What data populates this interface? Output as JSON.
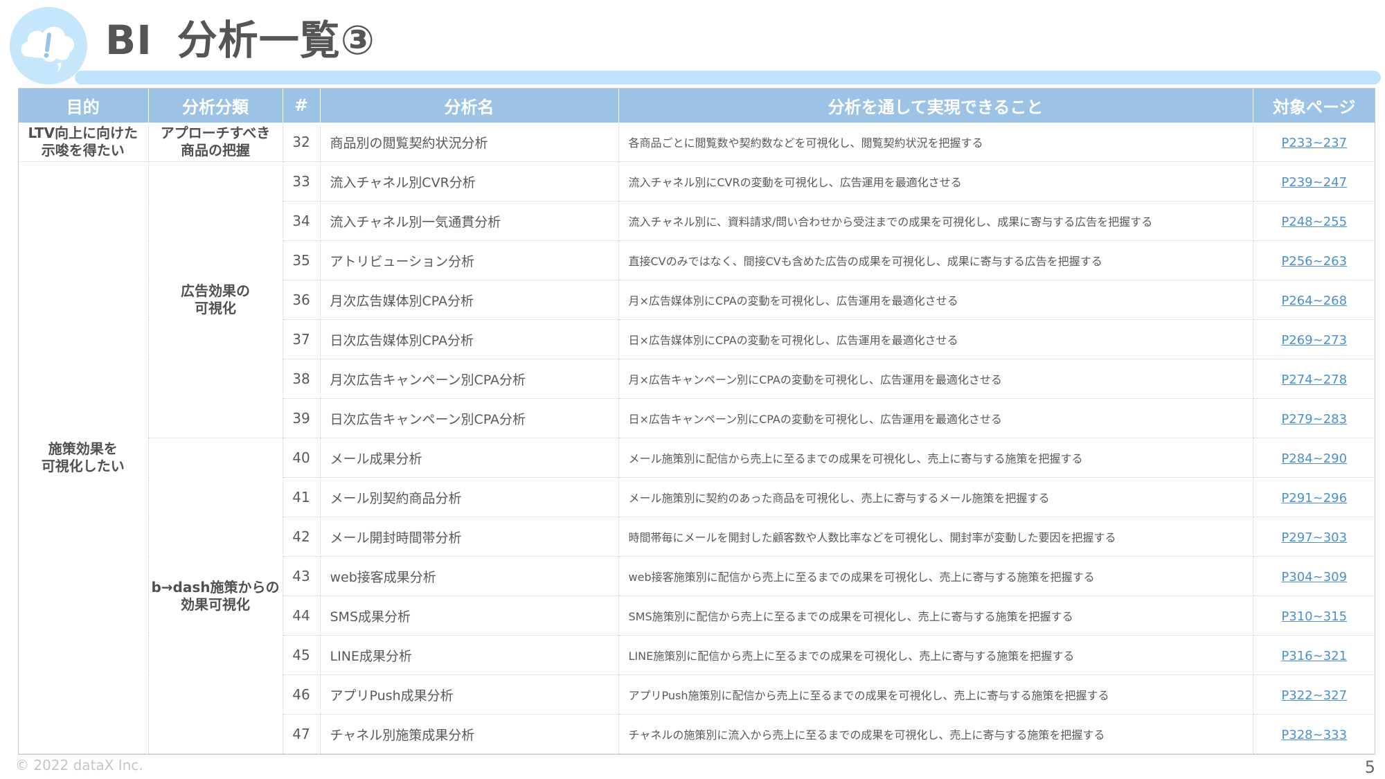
{
  "header": {
    "title_prefix": "BI",
    "title_main": "分析一覧③",
    "logo_icon": "cloud-exclamation-icon",
    "accent_color": "#c5e6fb",
    "header_color": "#9cc3e6",
    "link_color": "#4a8fd1"
  },
  "table": {
    "columns": [
      "目的",
      "分析分類",
      "#",
      "分析名",
      "分析を通して実現できること",
      "対象ページ"
    ],
    "purposes": [
      "LTV向上に向けた\n示唆を得たい",
      "施策効果を\n可視化したい"
    ],
    "categories": [
      "アプローチすべき\n商品の把握",
      "広告効果の\n可視化",
      "b→dash施策からの\n効果可視化"
    ],
    "rows": [
      {
        "num": "32",
        "name": "商品別の閲覧契約状況分析",
        "desc": "各商品ごとに閲覧数や契約数などを可視化し、閲覧契約状況を把握する",
        "page": "P233~237"
      },
      {
        "num": "33",
        "name": "流入チャネル別CVR分析",
        "desc": "流入チャネル別にCVRの変動を可視化し、広告運用を最適化させる",
        "page": "P239~247"
      },
      {
        "num": "34",
        "name": "流入チャネル別一気通貫分析",
        "desc": "流入チャネル別に、資料請求/問い合わせから受注までの成果を可視化し、成果に寄与する広告を把握する",
        "page": "P248~255"
      },
      {
        "num": "35",
        "name": "アトリビューション分析",
        "desc": "直接CVのみではなく、間接CVも含めた広告の成果を可視化し、成果に寄与する広告を把握する",
        "page": "P256~263"
      },
      {
        "num": "36",
        "name": "月次広告媒体別CPA分析",
        "desc": "月×広告媒体別にCPAの変動を可視化し、広告運用を最適化させる",
        "page": "P264~268"
      },
      {
        "num": "37",
        "name": "日次広告媒体別CPA分析",
        "desc": "日×広告媒体別にCPAの変動を可視化し、広告運用を最適化させる",
        "page": "P269~273"
      },
      {
        "num": "38",
        "name": "月次広告キャンペーン別CPA分析",
        "desc": "月×広告キャンペーン別にCPAの変動を可視化し、広告運用を最適化させる",
        "page": "P274~278"
      },
      {
        "num": "39",
        "name": "日次広告キャンペーン別CPA分析",
        "desc": "日×広告キャンペーン別にCPAの変動を可視化し、広告運用を最適化させる",
        "page": "P279~283"
      },
      {
        "num": "40",
        "name": "メール成果分析",
        "desc": "メール施策別に配信から売上に至るまでの成果を可視化し、売上に寄与する施策を把握する",
        "page": "P284~290"
      },
      {
        "num": "41",
        "name": "メール別契約商品分析",
        "desc": "メール施策別に契約のあった商品を可視化し、売上に寄与するメール施策を把握する",
        "page": "P291~296"
      },
      {
        "num": "42",
        "name": "メール開封時間帯分析",
        "desc": "時間帯毎にメールを開封した顧客数や人数比率などを可視化し、開封率が変動した要因を把握する",
        "page": "P297~303"
      },
      {
        "num": "43",
        "name": "web接客成果分析",
        "desc": "web接客施策別に配信から売上に至るまでの成果を可視化し、売上に寄与する施策を把握する",
        "page": "P304~309"
      },
      {
        "num": "44",
        "name": "SMS成果分析",
        "desc": "SMS施策別に配信から売上に至るまでの成果を可視化し、売上に寄与する施策を把握する",
        "page": "P310~315"
      },
      {
        "num": "45",
        "name": "LINE成果分析",
        "desc": "LINE施策別に配信から売上に至るまでの成果を可視化し、売上に寄与する施策を把握する",
        "page": "P316~321"
      },
      {
        "num": "46",
        "name": "アプリPush成果分析",
        "desc": "アプリPush施策別に配信から売上に至るまでの成果を可視化し、売上に寄与する施策を把握する",
        "page": "P322~327"
      },
      {
        "num": "47",
        "name": "チャネル別施策成果分析",
        "desc": "チャネルの施策別に流入から売上に至るまでの成果を可視化し、売上に寄与する施策を把握する",
        "page": "P328~333"
      }
    ]
  },
  "footer": {
    "copyright": "© 2022 dataX Inc.",
    "page_number": "5"
  }
}
